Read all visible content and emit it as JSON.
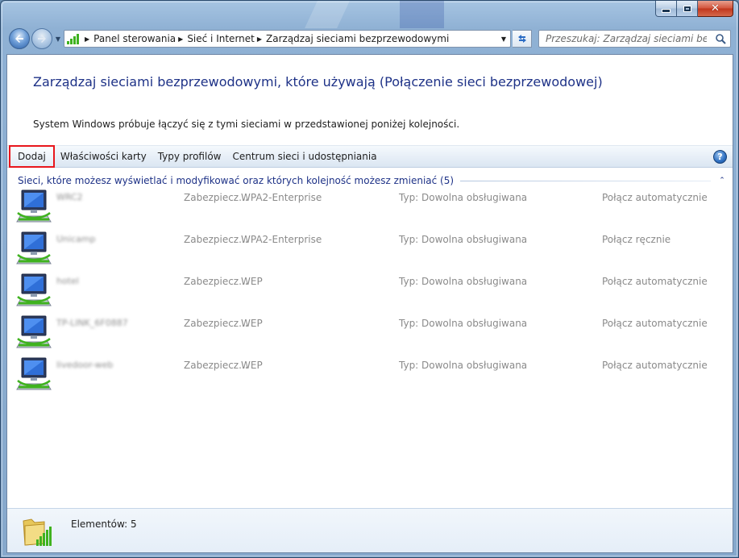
{
  "window": {
    "caption": {
      "minimize_glyph": "",
      "maximize_glyph": "",
      "close_glyph": "✕"
    }
  },
  "address": {
    "crumbs": [
      "Panel sterowania",
      "Sieć i Internet",
      "Zarządzaj sieciami bezprzewodowymi"
    ]
  },
  "search": {
    "placeholder": "Przeszukaj: Zarządzaj sieciami bezprz..."
  },
  "page": {
    "title": "Zarządzaj sieciami bezprzewodowymi, które używają (Połączenie sieci bezprzewodowej)",
    "description": "System Windows próbuje łączyć się z tymi sieciami w przedstawionej poniżej kolejności."
  },
  "toolbar": {
    "add": "Dodaj",
    "adapter_properties": "Właściwości karty",
    "profile_types": "Typy profilów",
    "network_center": "Centrum sieci i udostępniania",
    "help": "?"
  },
  "group": {
    "title": "Sieci, które możesz wyświetlać i modyfikować oraz których kolejność możesz zmieniać (5)",
    "collapse_glyph": "⌃"
  },
  "networks": [
    {
      "name": "WRC2",
      "security_label": "Zabezpiecz...",
      "security": "WPA2-Enterprise",
      "type_label": "Typ:",
      "type": "Dowolna obsługiwana",
      "connect": "Połącz automatycznie"
    },
    {
      "name": "Unicamp",
      "security_label": "Zabezpiecz...",
      "security": "WPA2-Enterprise",
      "type_label": "Typ:",
      "type": "Dowolna obsługiwana",
      "connect": "Połącz ręcznie"
    },
    {
      "name": "hotel",
      "security_label": "Zabezpiecz...",
      "security": "WEP",
      "type_label": "Typ:",
      "type": "Dowolna obsługiwana",
      "connect": "Połącz automatycznie"
    },
    {
      "name": "TP-LINK_6F0887",
      "security_label": "Zabezpiecz...",
      "security": "WEP",
      "type_label": "Typ:",
      "type": "Dowolna obsługiwana",
      "connect": "Połącz automatycznie"
    },
    {
      "name": "livedoor-web",
      "security_label": "Zabezpiecz...",
      "security": "WEP",
      "type_label": "Typ:",
      "type": "Dowolna obsługiwana",
      "connect": "Połącz automatycznie"
    }
  ],
  "status": {
    "items": "Elementów: 5"
  },
  "icons": {
    "back": "back-arrow-icon",
    "forward": "forward-arrow-icon",
    "address": "wireless-signal-icon",
    "refresh": "refresh-icon",
    "search": "search-icon",
    "network": "wireless-network-computer-icon",
    "status": "wireless-folder-icon",
    "help": "help-icon"
  },
  "colors": {
    "title_blue": "#1e3287",
    "highlight_border": "#e8161c",
    "signal_green": "#3fb21f"
  }
}
